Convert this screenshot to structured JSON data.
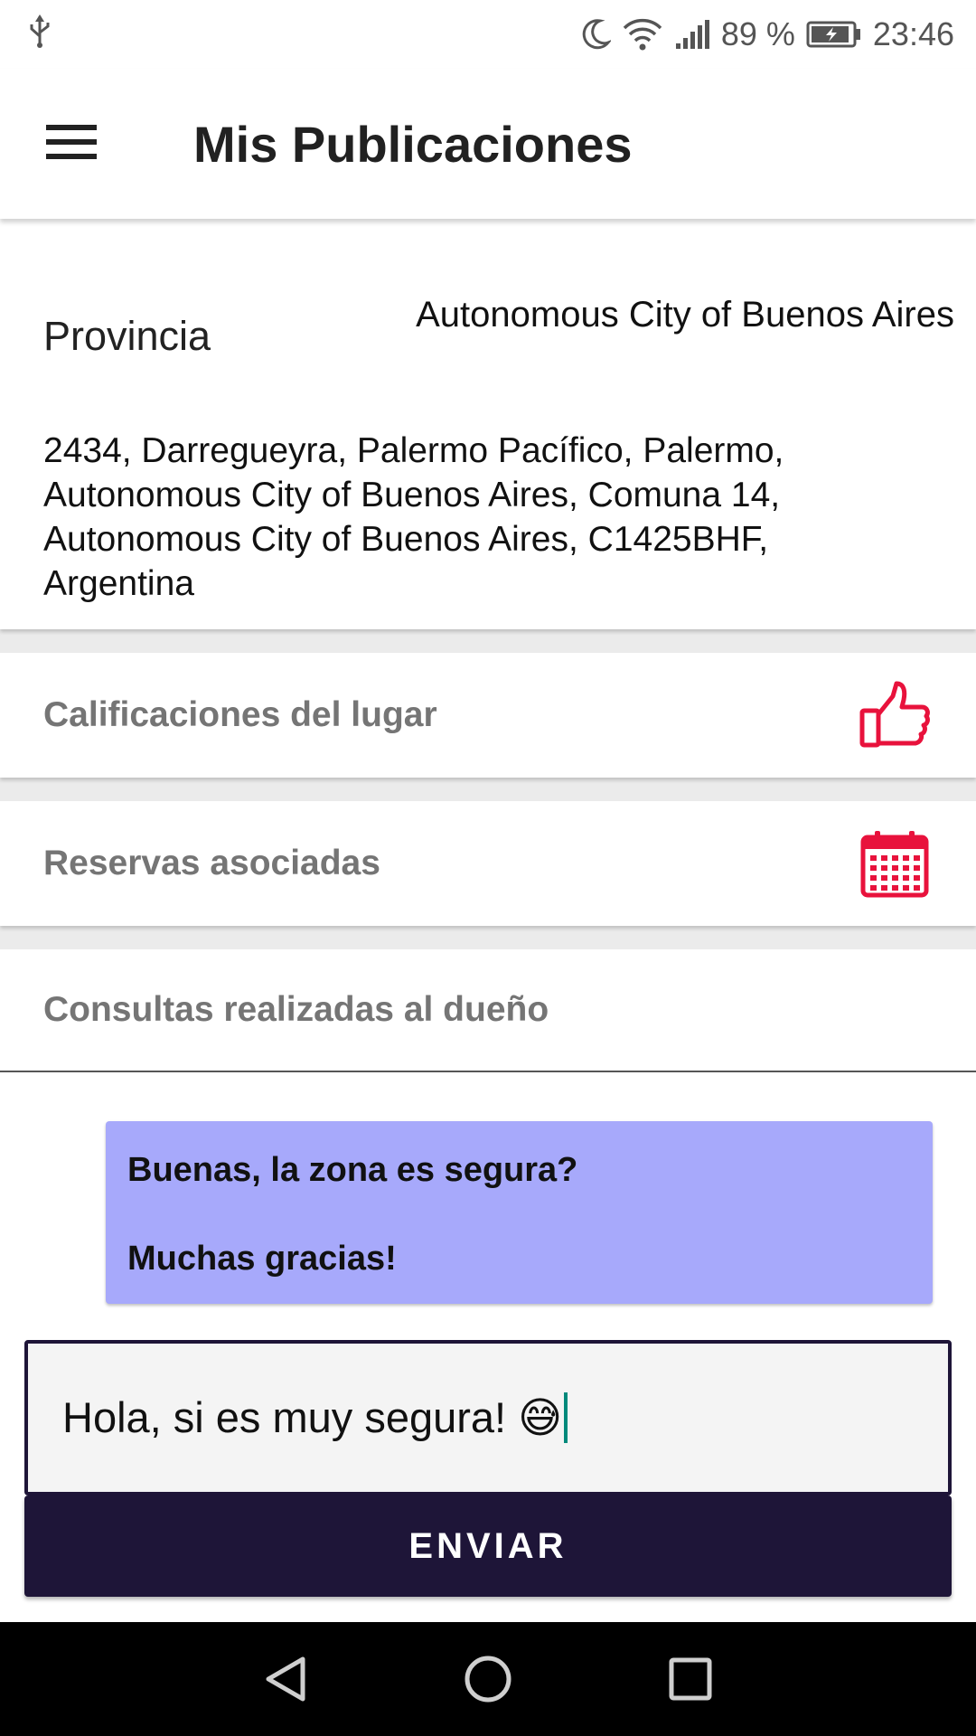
{
  "status_bar": {
    "battery_percent": "89 %",
    "time": "23:46",
    "icons": [
      "usb-icon",
      "moon-icon",
      "wifi-icon",
      "signal-icon",
      "battery-icon"
    ]
  },
  "app_bar": {
    "title": "Mis Publicaciones",
    "menu_icon": "hamburger-menu-icon"
  },
  "location": {
    "provincia_label": "Provincia",
    "provincia_value": "Autonomous City of Buenos Aires",
    "address_lines": [
      "2434, Darregueyra, Palermo Pacífico, Palermo,",
      "Autonomous City of Buenos Aires, Comuna 14,",
      "Autonomous City of Buenos Aires, C1425BHF,",
      "Argentina"
    ]
  },
  "sections": {
    "calificaciones": {
      "label": "Calificaciones del lugar",
      "icon": "thumbs-up-icon"
    },
    "reservas": {
      "label": "Reservas asociadas",
      "icon": "calendar-icon"
    },
    "consultas": {
      "label": "Consultas realizadas al dueño"
    }
  },
  "message": {
    "lines": [
      "Buenas, la zona es segura?",
      "Muchas gracias!"
    ]
  },
  "reply": {
    "value": "Hola, si es muy segura! 😅"
  },
  "send_button": {
    "label": "ENVIAR"
  },
  "nav_bar": {
    "icons": [
      "back-icon",
      "home-icon",
      "recents-icon"
    ]
  },
  "colors": {
    "accent_red": "#e8123c",
    "primary_dark": "#1e1538",
    "message_bg": "#a7a9fb",
    "cursor": "#00897b"
  }
}
